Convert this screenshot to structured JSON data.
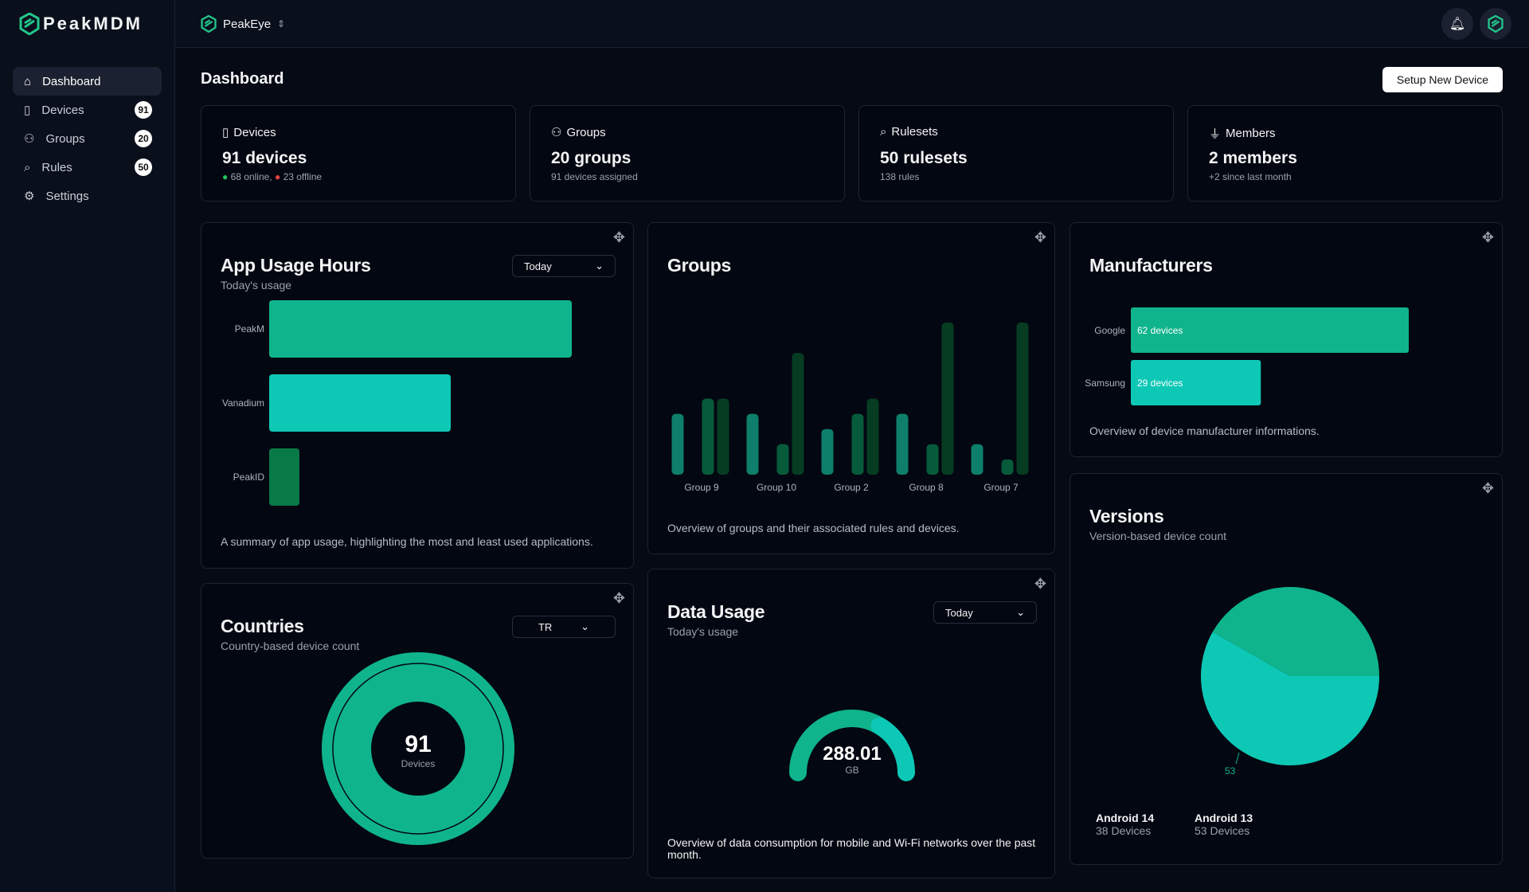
{
  "app": {
    "name": "PeakMDM",
    "workspace": "PeakEye"
  },
  "sidebar": {
    "items": [
      {
        "label": "Dashboard",
        "icon": "home-icon"
      },
      {
        "label": "Devices",
        "icon": "smartphone-icon",
        "badge": "91"
      },
      {
        "label": "Groups",
        "icon": "users-icon",
        "badge": "20"
      },
      {
        "label": "Rules",
        "icon": "tag-icon",
        "badge": "50"
      },
      {
        "label": "Settings",
        "icon": "gear-icon"
      }
    ]
  },
  "header": {
    "title": "Dashboard",
    "setup_button": "Setup New Device"
  },
  "stats": [
    {
      "label": "Devices",
      "value": "91 devices",
      "online": "68 online,",
      "offline": "23 offline"
    },
    {
      "label": "Groups",
      "value": "20 groups",
      "sub": "91 devices assigned"
    },
    {
      "label": "Rulesets",
      "value": "50 rulesets",
      "sub": "138 rules"
    },
    {
      "label": "Members",
      "value": "2 members",
      "sub": "+2 since last month"
    }
  ],
  "colors": {
    "emerald": "#10b48c",
    "teal": "#0ec8b6",
    "green": "#087a48",
    "dark_green": "#063d22",
    "online": "#22c55e",
    "offline": "#ef4444"
  },
  "app_usage": {
    "title": "App Usage Hours",
    "subtitle": "Today's usage",
    "range": "Today",
    "description": "A summary of app usage, highlighting the most and least used applications."
  },
  "groups_card": {
    "title": "Groups",
    "description": "Overview of groups and their associated rules and devices."
  },
  "manufacturers": {
    "title": "Manufacturers",
    "description": "Overview of device manufacturer informations."
  },
  "countries": {
    "title": "Countries",
    "subtitle": "Country-based device count",
    "country": "TR",
    "total": "91",
    "total_label": "Devices"
  },
  "data_usage": {
    "title": "Data Usage",
    "subtitle": "Today's usage",
    "range": "Today",
    "value": "288.01",
    "unit": "GB",
    "description": "Overview of data consumption for mobile and Wi-Fi networks over the past month."
  },
  "versions": {
    "title": "Versions",
    "subtitle": "Version-based device count",
    "legend": [
      {
        "name": "Android 14",
        "count": "38 Devices"
      },
      {
        "name": "Android 13",
        "count": "53 Devices"
      }
    ],
    "slice_label": "53"
  },
  "chart_data": [
    {
      "type": "bar",
      "orientation": "horizontal",
      "categories": [
        "PeakM",
        "Vanadium",
        "PeakID"
      ],
      "values": [
        10,
        6,
        1
      ]
    },
    {
      "type": "bar",
      "categories": [
        "Group 9",
        "Group 10",
        "Group 2",
        "Group 8",
        "Group 7"
      ],
      "series": [
        {
          "values": [
            4,
            4,
            3,
            4,
            2
          ]
        },
        {
          "values": [
            5,
            2,
            4,
            2,
            1
          ]
        },
        {
          "values": [
            5,
            8,
            5,
            10,
            10
          ]
        }
      ]
    },
    {
      "type": "bar",
      "orientation": "horizontal",
      "categories": [
        "Google",
        "Samsung"
      ],
      "values": [
        62,
        29
      ],
      "data_labels": [
        "62 devices",
        "29 devices"
      ]
    },
    {
      "type": "pie",
      "categories": [
        "TR"
      ],
      "values": [
        91
      ]
    },
    {
      "type": "pie",
      "style": "gauge",
      "shares": [
        0.67,
        0.33
      ]
    },
    {
      "type": "pie",
      "categories": [
        "Android 14",
        "Android 13"
      ],
      "values": [
        38,
        53
      ]
    }
  ]
}
